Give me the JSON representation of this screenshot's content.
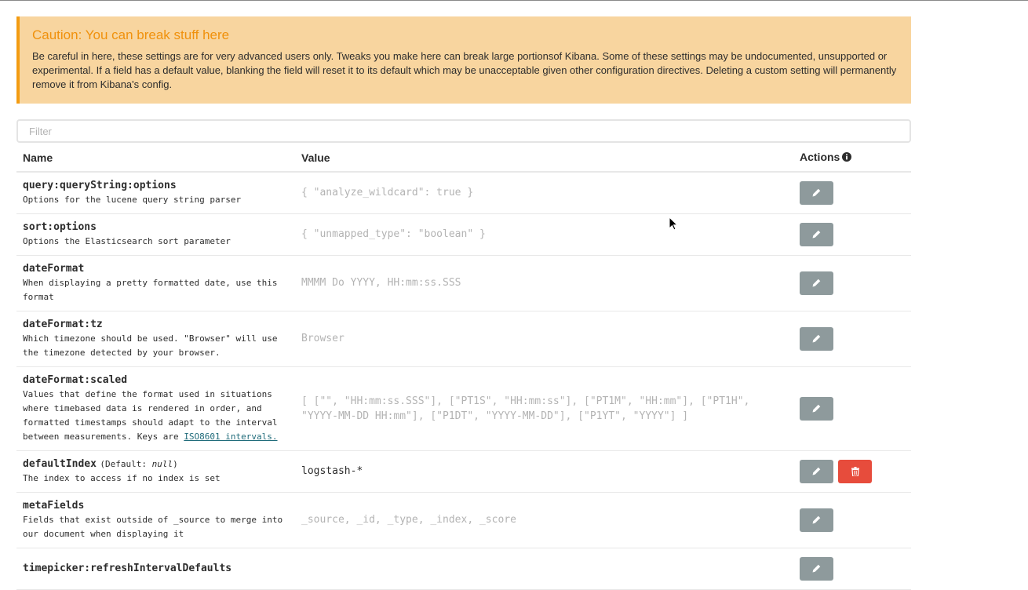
{
  "caution": {
    "title": "Caution: You can break stuff here",
    "body": "Be careful in here, these settings are for very advanced users only. Tweaks you make here can break large portionsof Kibana. Some of these settings may be undocumented, unsupported or experimental. If a field has a default value, blanking the field will reset it to its default which may be unacceptable given other configuration directives. Deleting a custom setting will permanently remove it from Kibana's config."
  },
  "filter": {
    "placeholder": "Filter"
  },
  "table": {
    "headers": {
      "name": "Name",
      "value": "Value",
      "actions": "Actions"
    },
    "rows": [
      {
        "name": "query:queryString:options",
        "description": "Options for the lucene query string parser",
        "value": "{ \"analyze_wildcard\": true }"
      },
      {
        "name": "sort:options",
        "description": "Options the Elasticsearch sort parameter",
        "value": "{ \"unmapped_type\": \"boolean\" }"
      },
      {
        "name": "dateFormat",
        "description": "When displaying a pretty formatted date, use this format",
        "value": "MMMM Do YYYY, HH:mm:ss.SSS"
      },
      {
        "name": "dateFormat:tz",
        "description": "Which timezone should be used. \"Browser\" will use the timezone detected by your browser.",
        "value": "Browser"
      },
      {
        "name": "dateFormat:scaled",
        "description": "Values that define the format used in situations where timebased data is rendered in order, and formatted timestamps should adapt to the interval between measurements. Keys are",
        "link": "ISO8601 intervals.",
        "value": "[ [\"\", \"HH:mm:ss.SSS\"], [\"PT1S\", \"HH:mm:ss\"], [\"PT1M\", \"HH:mm\"], [\"PT1H\", \"YYYY-MM-DD HH:mm\"], [\"P1DT\", \"YYYY-MM-DD\"], [\"P1YT\", \"YYYY\"] ]"
      },
      {
        "name": "defaultIndex",
        "default_prefix": "(Default: ",
        "default_value": "null",
        "default_suffix": ")",
        "description": "The index to access if no index is set",
        "value": "logstash-*"
      },
      {
        "name": "metaFields",
        "description": "Fields that exist outside of _source to merge into our document when displaying it",
        "value": "_source, _id, _type, _index, _score"
      },
      {
        "name": "timepicker:refreshIntervalDefaults",
        "description": "",
        "value": ""
      }
    ]
  },
  "colors": {
    "warning_bg": "#f8d59f",
    "warning_title": "#f0910c",
    "edit_button": "#8e9a9c",
    "delete_button": "#e74c3c"
  },
  "icons": {
    "edit": "pencil-icon",
    "delete": "trash-icon",
    "info": "info-circle-icon",
    "cursor": "mouse-pointer"
  }
}
